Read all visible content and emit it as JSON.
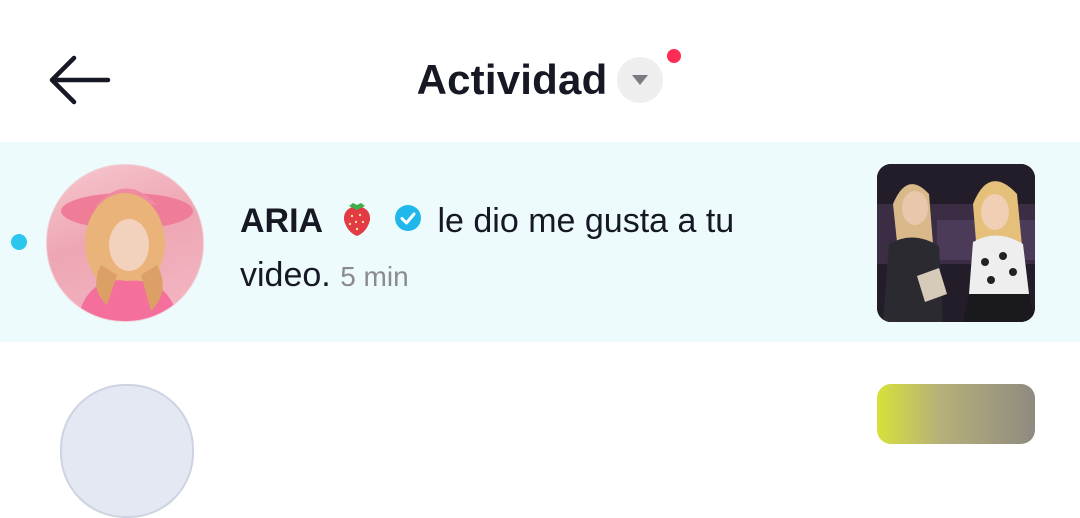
{
  "header": {
    "title": "Actividad",
    "back_icon": "arrow-left-icon",
    "dropdown_icon": "triangle-down-icon",
    "has_unseen_indicator": true
  },
  "notifications": [
    {
      "username": "ARIA",
      "name_emoji": "strawberry",
      "verified": true,
      "message_line1": "le dio me gusta a tu",
      "message_line2": "video.",
      "time": "5 min",
      "unread": true
    }
  ],
  "colors": {
    "unread_background": "#edfbfd",
    "unread_dot": "#2bc6ee",
    "verified_badge": "#20b8ea",
    "red_indicator": "#fe2c55",
    "text_primary": "#161823",
    "text_secondary": "#8a8b91"
  }
}
